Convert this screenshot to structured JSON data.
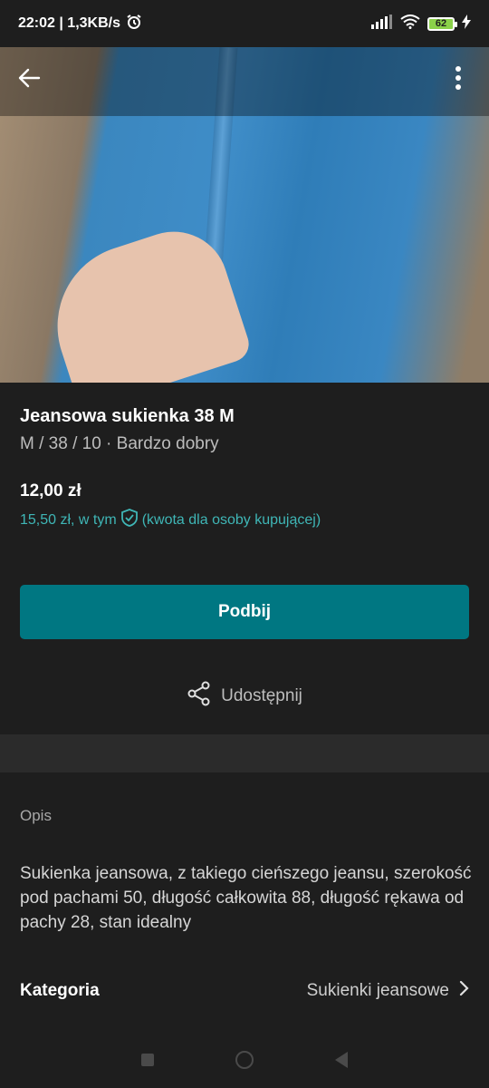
{
  "status_bar": {
    "time_speed": "22:02 | 1,3KB/s",
    "battery": "62",
    "icons": [
      "alarm-icon",
      "signal-icon",
      "wifi-icon",
      "battery-icon",
      "charging-icon"
    ]
  },
  "toolbar": {
    "back_icon": "arrow-left-icon",
    "menu_icon": "more-vert-icon"
  },
  "item": {
    "title": "Jeansowa sukienka 38 M",
    "subtitle": "M / 38 / 10 · Bardzo dobry",
    "price": "12,00 zł",
    "price_total": "15,50 zł, w tym",
    "price_note": "(kwota dla osoby kupującej)"
  },
  "actions": {
    "primary_label": "Podbij",
    "share_label": "Udostępnij"
  },
  "description": {
    "label": "Opis",
    "text": "Sukienka jeansowa, z takiego cieńszego jeansu, szerokość pod pachami 50, długość całkowita 88, długość rękawa od pachy 28, stan idealny"
  },
  "category": {
    "label": "Kategoria",
    "value": "Sukienki jeansowe"
  },
  "colors": {
    "accent": "#007782",
    "accent_text": "#3fb6b6",
    "background": "#1e1e1e"
  }
}
